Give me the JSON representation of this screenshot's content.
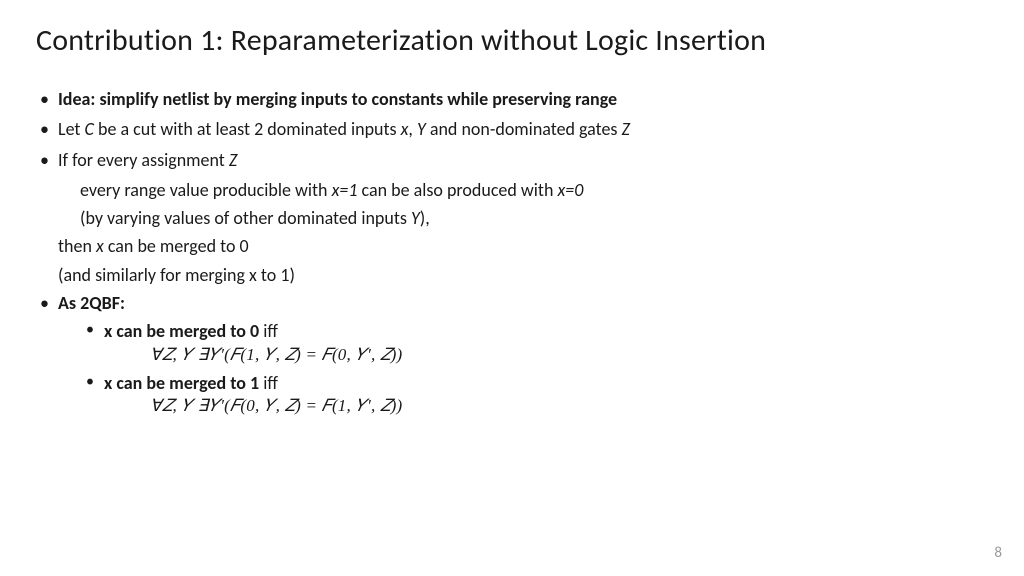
{
  "title": "Contribution 1: Reparameterization without Logic Insertion",
  "idea_label": "Idea: simplify netlist by merging inputs to constants while preserving range",
  "let_c_pre": "Let ",
  "let_c_c": "C",
  "let_c_mid1": " be a cut with at least 2 dominated inputs ",
  "let_c_x": "x",
  "let_c_comma": ", ",
  "let_c_y": "Y",
  "let_c_mid2": " and non-dominated gates ",
  "let_c_z": "Z",
  "if_pre": "If for every assignment ",
  "if_z": "Z",
  "range_pre": "every range value producible with ",
  "range_x1": "x=1",
  "range_mid": " can be also produced with ",
  "range_x0": "x=0",
  "byvary_pre": "(by varying values of other dominated inputs ",
  "byvary_y": "Y",
  "byvary_post": "),",
  "then_pre": "then ",
  "then_x": "x",
  "then_post": " can be merged to 0",
  "similar": "(and similarly for merging x to 1)",
  "as2qbf": "As 2QBF:",
  "merge0_bold": "x can be merged to 0",
  "merge0_iff": " iff",
  "formula0": "∀𝑍, 𝑌 ∃𝑌′(𝐹(1, 𝑌, 𝑍) = 𝐹(0, 𝑌′, 𝑍))",
  "merge1_bold": "x can be merged to 1",
  "merge1_iff": " iff",
  "formula1": "∀𝑍, 𝑌 ∃𝑌′(𝐹(0, 𝑌, 𝑍) = 𝐹(1, 𝑌′, 𝑍))",
  "pagenum": "8"
}
